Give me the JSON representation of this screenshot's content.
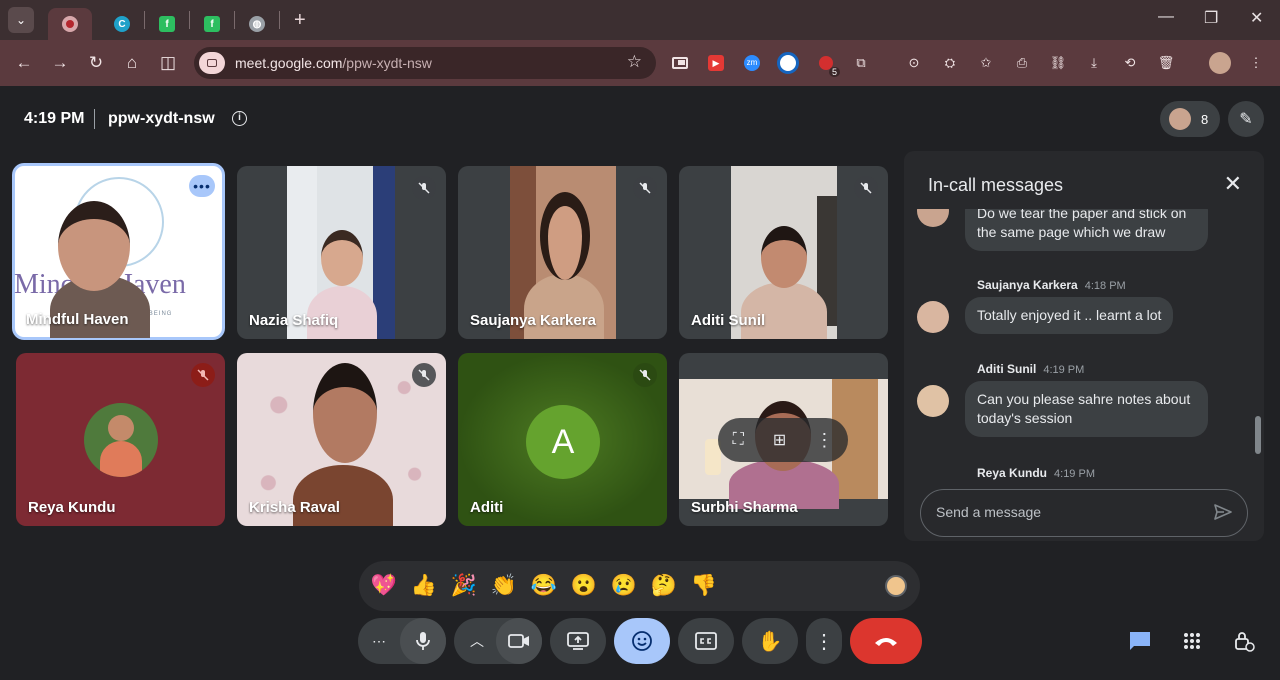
{
  "browser": {
    "url_host": "meet.google.com",
    "url_path": "/ppw-xydt-nsw",
    "extension_badge_count": "5",
    "ext_zm_label": "zm",
    "tab_icons": [
      "meet-icon",
      "circle-c-icon",
      "evernote-icon",
      "evernote-icon",
      "globe-icon"
    ],
    "tab_icon_labels": [
      "C",
      "f",
      "f"
    ]
  },
  "meeting": {
    "time": "4:19 PM",
    "code": "ppw-xydt-nsw",
    "participant_count": "8"
  },
  "participants": [
    {
      "name": "Mindful Haven",
      "muted": false,
      "active_speaker": true,
      "bg_text": "Mindful Haven",
      "bg_subtext": "COUNSELLING • WELLBEING"
    },
    {
      "name": "Nazia Shafiq",
      "muted": true
    },
    {
      "name": "Saujanya Karkera",
      "muted": true
    },
    {
      "name": "Aditi Sunil",
      "muted": true
    },
    {
      "name": "Reya Kundu",
      "muted": true
    },
    {
      "name": "Krisha Raval",
      "muted": true
    },
    {
      "name": "Aditi",
      "muted": true,
      "initial": "A"
    },
    {
      "name": "Surbhi Sharma",
      "muted": false
    }
  ],
  "chat": {
    "title": "In-call messages",
    "messages": [
      {
        "sender": "",
        "time": "",
        "text": "Do we tear the paper and stick on the same page which we draw"
      },
      {
        "sender": "Saujanya Karkera",
        "time": "4:18 PM",
        "text": "Totally enjoyed it .. learnt a lot"
      },
      {
        "sender": "Aditi Sunil",
        "time": "4:19 PM",
        "text": "Can you please sahre notes about today's session"
      },
      {
        "sender": "Reya Kundu",
        "time": "4:19 PM",
        "text": ""
      }
    ],
    "placeholder": "Send a message"
  },
  "reactions": [
    "💖",
    "👍",
    "🎉",
    "👏",
    "😂",
    "😮",
    "😢",
    "🤔",
    "👎"
  ],
  "colors": {
    "accent": "#a8c7fa",
    "end_call": "#dc362e",
    "tab_bar": "#3c2f31",
    "toolbar": "#5b3a3e",
    "surface": "#202124"
  }
}
